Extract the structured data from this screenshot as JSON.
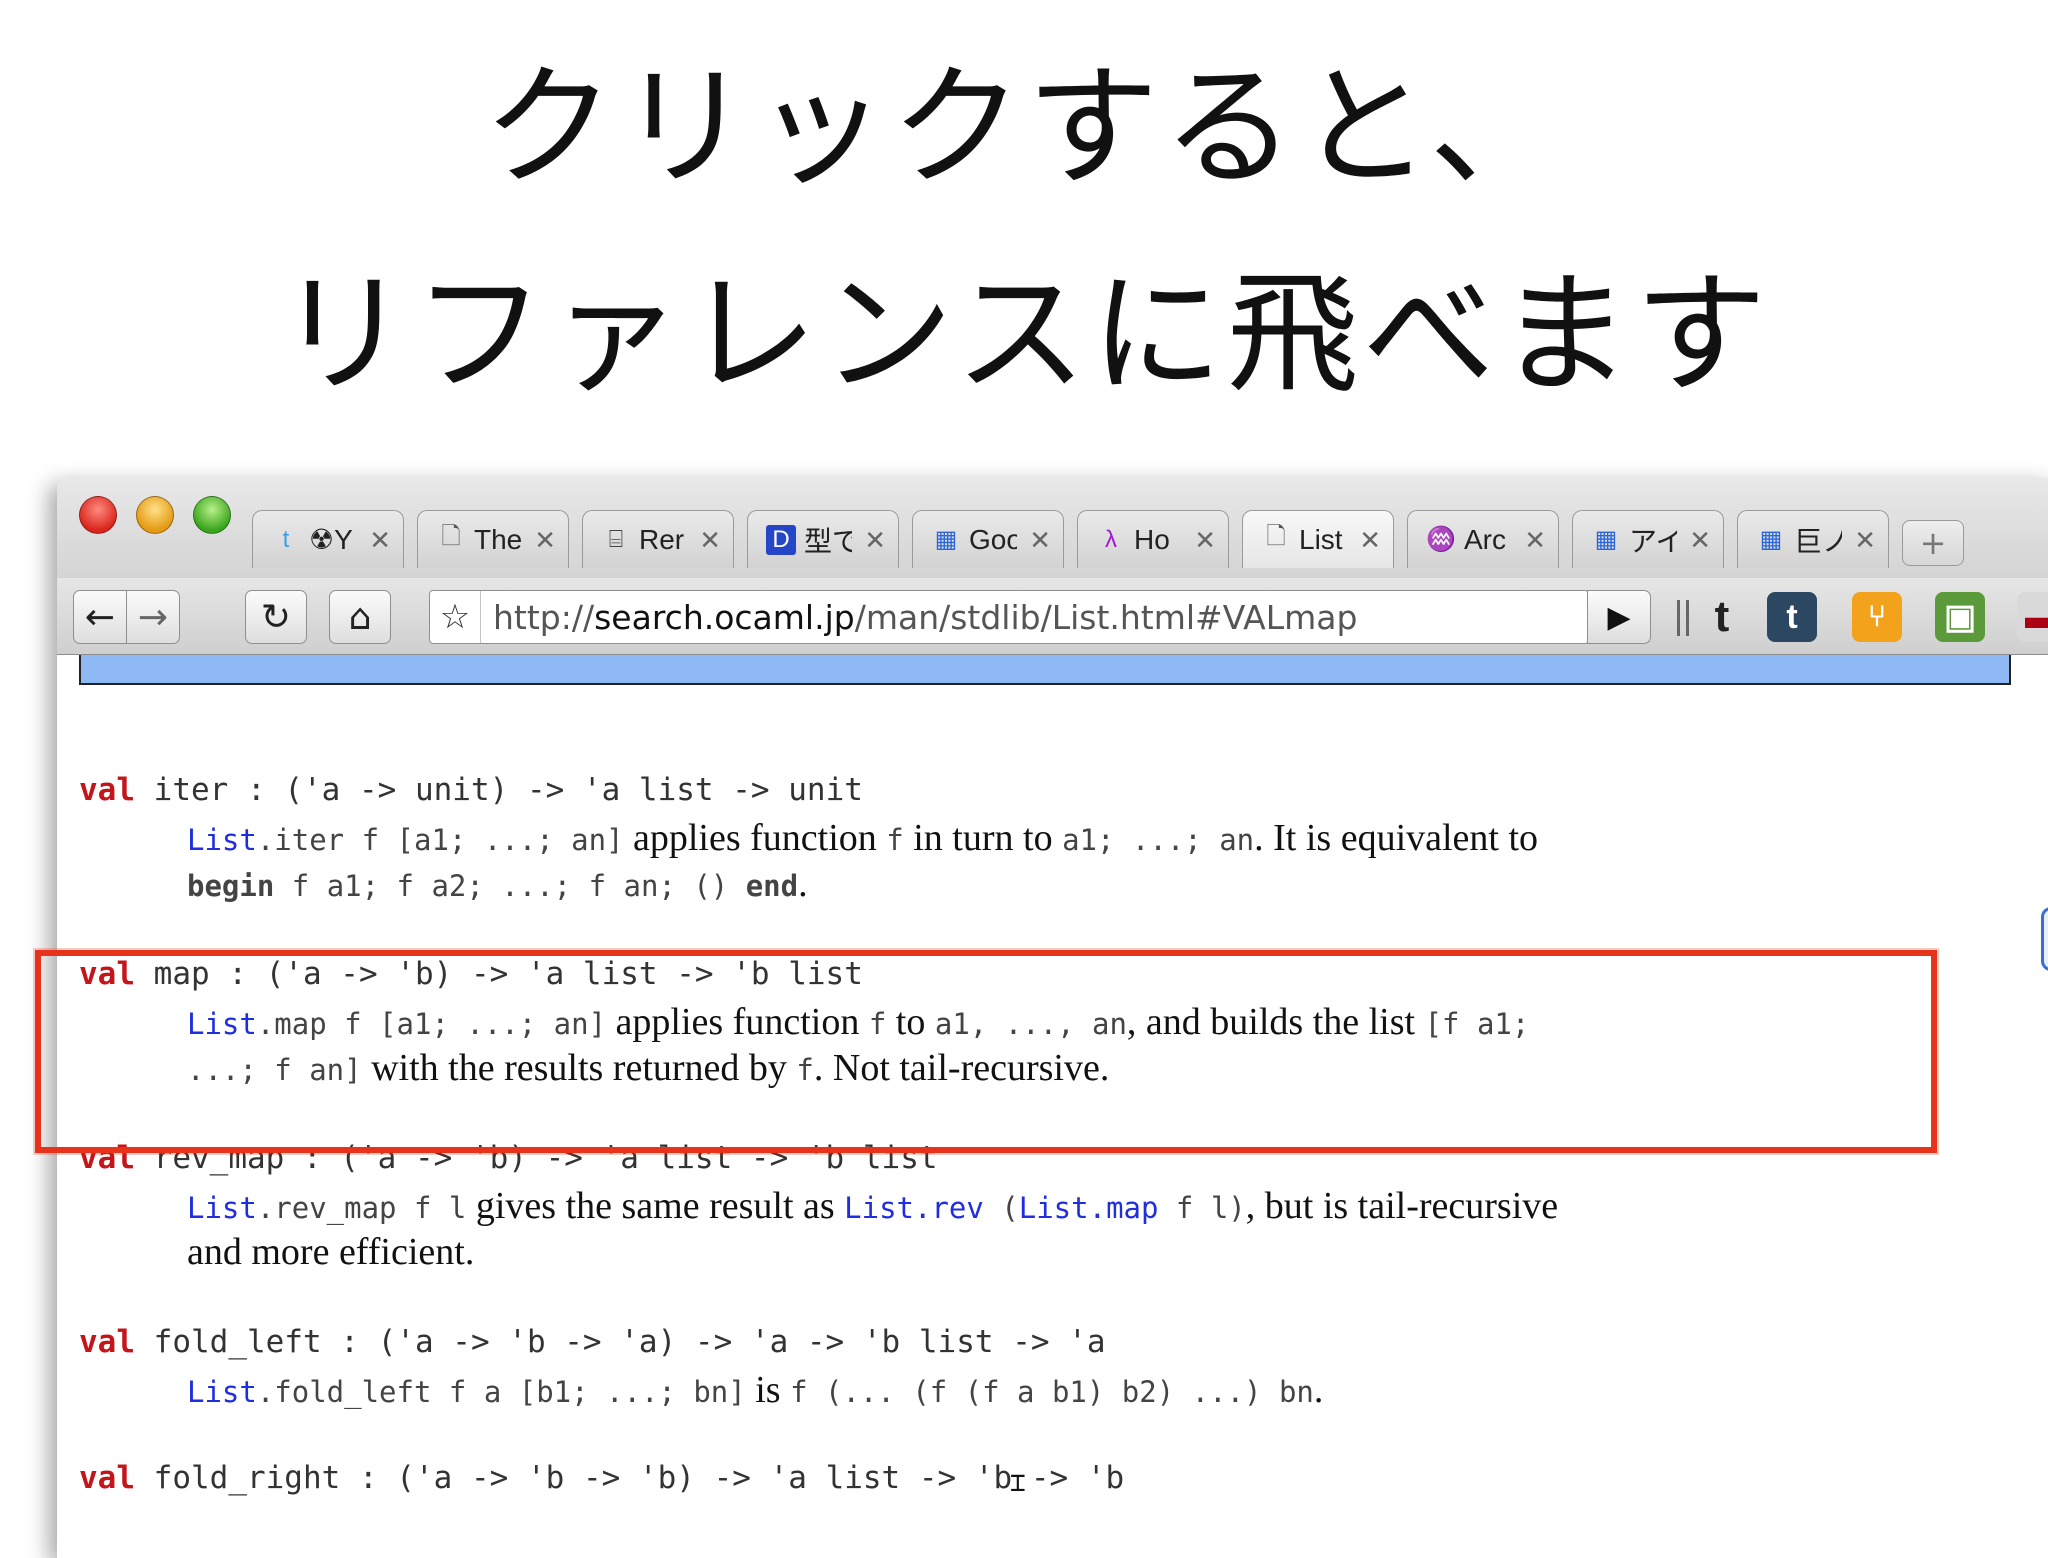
{
  "slide": {
    "title_line1": "クリックすると、",
    "title_line2": "リファレンスに飛べます"
  },
  "browser": {
    "tabs": [
      {
        "icon": "twitter-icon",
        "label": "☢Y",
        "active": false
      },
      {
        "icon": "page-icon",
        "label": "The",
        "active": false
      },
      {
        "icon": "robot-icon",
        "label": "Rer",
        "active": false
      },
      {
        "icon": "d-icon",
        "label": "型で",
        "active": false
      },
      {
        "icon": "google-icon",
        "label": "Goo",
        "active": false
      },
      {
        "icon": "lambda-icon",
        "label": "Ho",
        "active": false
      },
      {
        "icon": "page-icon",
        "label": "List",
        "active": true
      },
      {
        "icon": "camel-icon",
        "label": "Arc",
        "active": false
      },
      {
        "icon": "google-icon",
        "label": "アイ",
        "active": false
      },
      {
        "icon": "google-icon",
        "label": "巨ノ",
        "active": false
      }
    ],
    "url_scheme": "http://",
    "url_host": "search.ocaml.jp",
    "url_path": "/man/stdlib/List.html#VALmap"
  },
  "doc": {
    "entries": [
      {
        "kw": "val",
        "name": " iter",
        "type": " : ('a -> unit) -> 'a list -> unit",
        "desc_lines": [
          [
            {
              "t": "List",
              "c": "mod"
            },
            {
              "t": ".iter f [a1; ...; an]",
              "c": "code"
            },
            {
              "t": " applies function ",
              "c": "text"
            },
            {
              "t": "f",
              "c": "code"
            },
            {
              "t": " in turn to ",
              "c": "text"
            },
            {
              "t": "a1; ...; an",
              "c": "code"
            },
            {
              "t": ". It is equivalent to",
              "c": "text"
            }
          ],
          [
            {
              "t": "begin",
              "c": "kw"
            },
            {
              "t": " f a1; f a2; ...; f an; () ",
              "c": "code"
            },
            {
              "t": "end",
              "c": "kw"
            },
            {
              "t": ".",
              "c": "text"
            }
          ]
        ]
      },
      {
        "kw": "val",
        "name": " map",
        "type": " : ('a -> 'b) -> 'a list -> 'b list",
        "desc_lines": [
          [
            {
              "t": "List",
              "c": "mod"
            },
            {
              "t": ".map f [a1; ...; an]",
              "c": "code"
            },
            {
              "t": " applies function ",
              "c": "text"
            },
            {
              "t": "f",
              "c": "code"
            },
            {
              "t": " to ",
              "c": "text"
            },
            {
              "t": "a1, ..., an",
              "c": "code"
            },
            {
              "t": ", and builds the list ",
              "c": "text"
            },
            {
              "t": "[f a1;",
              "c": "code"
            }
          ],
          [
            {
              "t": "...; f an]",
              "c": "code"
            },
            {
              "t": " with the results returned by ",
              "c": "text"
            },
            {
              "t": "f",
              "c": "code"
            },
            {
              "t": ". Not tail-recursive.",
              "c": "text"
            }
          ]
        ]
      },
      {
        "kw": "val",
        "name": " rev_map",
        "type": " : ('a -> 'b) -> 'a list -> 'b list",
        "desc_lines": [
          [
            {
              "t": "List",
              "c": "mod"
            },
            {
              "t": ".rev_map f l",
              "c": "code"
            },
            {
              "t": " gives the same result as ",
              "c": "text"
            },
            {
              "t": "List",
              "c": "mod"
            },
            {
              "t": ".rev",
              "c": "mod"
            },
            {
              "t": " (",
              "c": "code"
            },
            {
              "t": "List",
              "c": "mod"
            },
            {
              "t": ".map",
              "c": "mod"
            },
            {
              "t": " f l)",
              "c": "code"
            },
            {
              "t": ", but is tail-recursive",
              "c": "text"
            }
          ],
          [
            {
              "t": "and more efficient.",
              "c": "text"
            }
          ]
        ]
      },
      {
        "kw": "val",
        "name": " fold_left",
        "type": " : ('a -> 'b -> 'a) -> 'a -> 'b list -> 'a",
        "desc_lines": [
          [
            {
              "t": "List",
              "c": "mod"
            },
            {
              "t": ".fold_left f a [b1; ...; bn]",
              "c": "code"
            },
            {
              "t": " is ",
              "c": "text"
            },
            {
              "t": "f (... (f (f a b1) b2) ...) bn",
              "c": "code"
            },
            {
              "t": ".",
              "c": "text"
            }
          ]
        ]
      },
      {
        "kw": "val",
        "name": " fold_right",
        "type": " : ('a -> 'b -> 'b) -> 'a list -> 'b -> 'b",
        "desc_lines": []
      }
    ]
  },
  "colors": {
    "keyword": "#c4151b",
    "module": "#1f2ee0",
    "highlight_box": "#e8331c",
    "nav_bar": "#8fb9f5"
  }
}
